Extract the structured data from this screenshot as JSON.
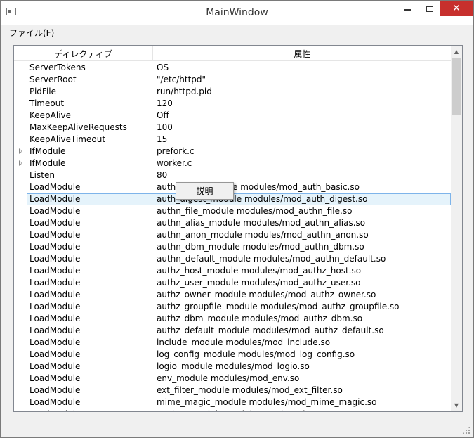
{
  "window": {
    "title": "MainWindow"
  },
  "menu": {
    "file": "ファイル(F)"
  },
  "tree": {
    "columns": [
      "ディレクティブ",
      "属性"
    ],
    "rows": [
      {
        "key": "ServerTokens",
        "value": "OS",
        "expandable": false
      },
      {
        "key": "ServerRoot",
        "value": "\"/etc/httpd\"",
        "expandable": false
      },
      {
        "key": "PidFile",
        "value": "run/httpd.pid",
        "expandable": false
      },
      {
        "key": "Timeout",
        "value": "120",
        "expandable": false
      },
      {
        "key": "KeepAlive",
        "value": "Off",
        "expandable": false
      },
      {
        "key": "MaxKeepAliveRequests",
        "value": "100",
        "expandable": false
      },
      {
        "key": "KeepAliveTimeout",
        "value": "15",
        "expandable": false
      },
      {
        "key": "IfModule",
        "value": "prefork.c",
        "expandable": true
      },
      {
        "key": "IfModule",
        "value": "worker.c",
        "expandable": true
      },
      {
        "key": "Listen",
        "value": "80",
        "expandable": false
      },
      {
        "key": "LoadModule",
        "value": "auth_basic_module modules/mod_auth_basic.so",
        "expandable": false
      },
      {
        "key": "LoadModule",
        "value": "auth_digest_module modules/mod_auth_digest.so",
        "expandable": false,
        "selected": true
      },
      {
        "key": "LoadModule",
        "value": "authn_file_module modules/mod_authn_file.so",
        "expandable": false
      },
      {
        "key": "LoadModule",
        "value": "authn_alias_module modules/mod_authn_alias.so",
        "expandable": false
      },
      {
        "key": "LoadModule",
        "value": "authn_anon_module modules/mod_authn_anon.so",
        "expandable": false
      },
      {
        "key": "LoadModule",
        "value": "authn_dbm_module modules/mod_authn_dbm.so",
        "expandable": false
      },
      {
        "key": "LoadModule",
        "value": "authn_default_module modules/mod_authn_default.so",
        "expandable": false
      },
      {
        "key": "LoadModule",
        "value": "authz_host_module modules/mod_authz_host.so",
        "expandable": false
      },
      {
        "key": "LoadModule",
        "value": "authz_user_module modules/mod_authz_user.so",
        "expandable": false
      },
      {
        "key": "LoadModule",
        "value": "authz_owner_module modules/mod_authz_owner.so",
        "expandable": false
      },
      {
        "key": "LoadModule",
        "value": "authz_groupfile_module modules/mod_authz_groupfile.so",
        "expandable": false
      },
      {
        "key": "LoadModule",
        "value": "authz_dbm_module modules/mod_authz_dbm.so",
        "expandable": false
      },
      {
        "key": "LoadModule",
        "value": "authz_default_module modules/mod_authz_default.so",
        "expandable": false
      },
      {
        "key": "LoadModule",
        "value": "include_module modules/mod_include.so",
        "expandable": false
      },
      {
        "key": "LoadModule",
        "value": "log_config_module modules/mod_log_config.so",
        "expandable": false
      },
      {
        "key": "LoadModule",
        "value": "logio_module modules/mod_logio.so",
        "expandable": false
      },
      {
        "key": "LoadModule",
        "value": "env_module modules/mod_env.so",
        "expandable": false
      },
      {
        "key": "LoadModule",
        "value": "ext_filter_module modules/mod_ext_filter.so",
        "expandable": false
      },
      {
        "key": "LoadModule",
        "value": "mime_magic_module modules/mod_mime_magic.so",
        "expandable": false
      },
      {
        "key": "LoadModule",
        "value": "expires_module modules/mod_expires.so",
        "expandable": false
      }
    ]
  },
  "context_menu": {
    "items": [
      "説明"
    ]
  },
  "colors": {
    "selection_bg": "#e5f3fb",
    "selection_border": "#7eb4ea",
    "close_button": "#c7302d"
  }
}
